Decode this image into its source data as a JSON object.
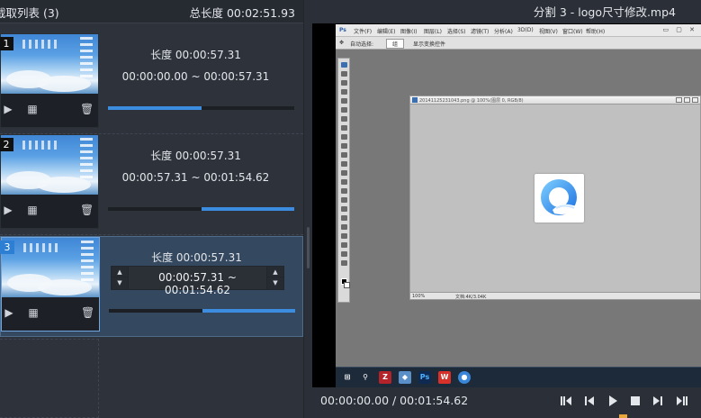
{
  "left_panel": {
    "title": "截取列表 (3)",
    "total_length": "总长度 00:02:51.93",
    "clips": [
      {
        "number": "1",
        "length": "长度 00:00:57.31",
        "range": "00:00:00.00 ~ 00:00:57.31",
        "bar_start": 0.0,
        "bar_end": 0.5,
        "selected": false
      },
      {
        "number": "2",
        "length": "长度 00:00:57.31",
        "range": "00:00:57.31 ~ 00:01:54.62",
        "bar_start": 0.5,
        "bar_end": 1.0,
        "selected": false
      },
      {
        "number": "3",
        "length": "长度 00:00:57.31",
        "range": "00:00:57.31 ~ 00:01:54.62",
        "bar_start": 0.5,
        "bar_end": 1.0,
        "selected": true
      }
    ],
    "clip_tools": [
      "play-icon",
      "grid-icon",
      "trash-icon"
    ]
  },
  "right_panel": {
    "title": "分割 3 - logo尺寸修改.mp4",
    "timecode": "00:00:00.00 / 00:01:54.62",
    "controls": [
      "prev-frame-icon",
      "step-back-icon",
      "play-icon",
      "stop-icon",
      "step-forward-icon",
      "next-frame-icon"
    ]
  },
  "video_frame": {
    "menu": [
      "文件(F)",
      "编辑(E)",
      "图像(I)",
      "图层(L)",
      "选择(S)",
      "滤镜(T)",
      "分析(A)",
      "3D(D)",
      "视图(V)",
      "窗口(W)",
      "帮助(H)"
    ],
    "options": [
      "自动选择:",
      "组",
      "显示变换控件"
    ],
    "doc_title": "20141125231043.png @ 100%(图层 0, RGB/8)",
    "zoom": "100%",
    "doc_info": "文档:4K/3.04K"
  },
  "colors": {
    "accent": "#3c8de0",
    "selected_bg": "#34485f",
    "marker": "#e8a73a"
  }
}
